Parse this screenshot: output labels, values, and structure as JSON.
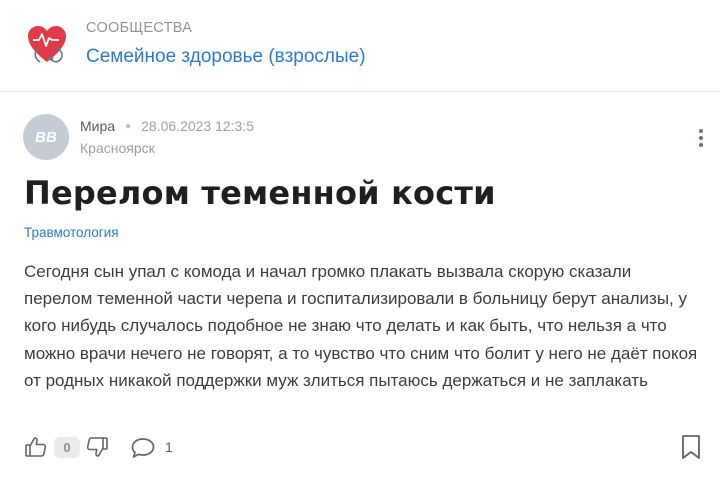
{
  "community": {
    "section_label": "СООБЩЕСТВА",
    "name": "Семейное здоровье (взрослые)",
    "logo_icon": "heart-stethoscope-icon"
  },
  "post": {
    "author": {
      "avatar_initials": "BB",
      "name": "Мира",
      "city": "Красноярск"
    },
    "date": "28.06.2023 12:3:5",
    "title": "Перелом теменной кости",
    "tag": "Травмотология",
    "body": "Сегодня сын упал с комода и начал громко плакать вызвала скорую сказали перелом теменной части черепа и госпитализировали в больницу берут анализы, у кого нибудь случалось подобное не знаю что делать и как быть, что нельзя а что можно врачи нечего не говорят, а то чувство что сним что болит у него не даёт покоя от родных никакой поддержки муж злиться пытаюсь держаться и не заплакать"
  },
  "actions": {
    "score": "0",
    "comment_count": "1",
    "icons": [
      "thumbs-up-icon",
      "thumbs-down-icon",
      "comment-icon",
      "bookmark-icon",
      "more-vertical-icon"
    ]
  },
  "colors": {
    "accent_link": "#2a7bd1",
    "muted_text": "#9aa0a8",
    "logo_red": "#e33a4a",
    "avatar_bg": "#c5ccd4"
  }
}
